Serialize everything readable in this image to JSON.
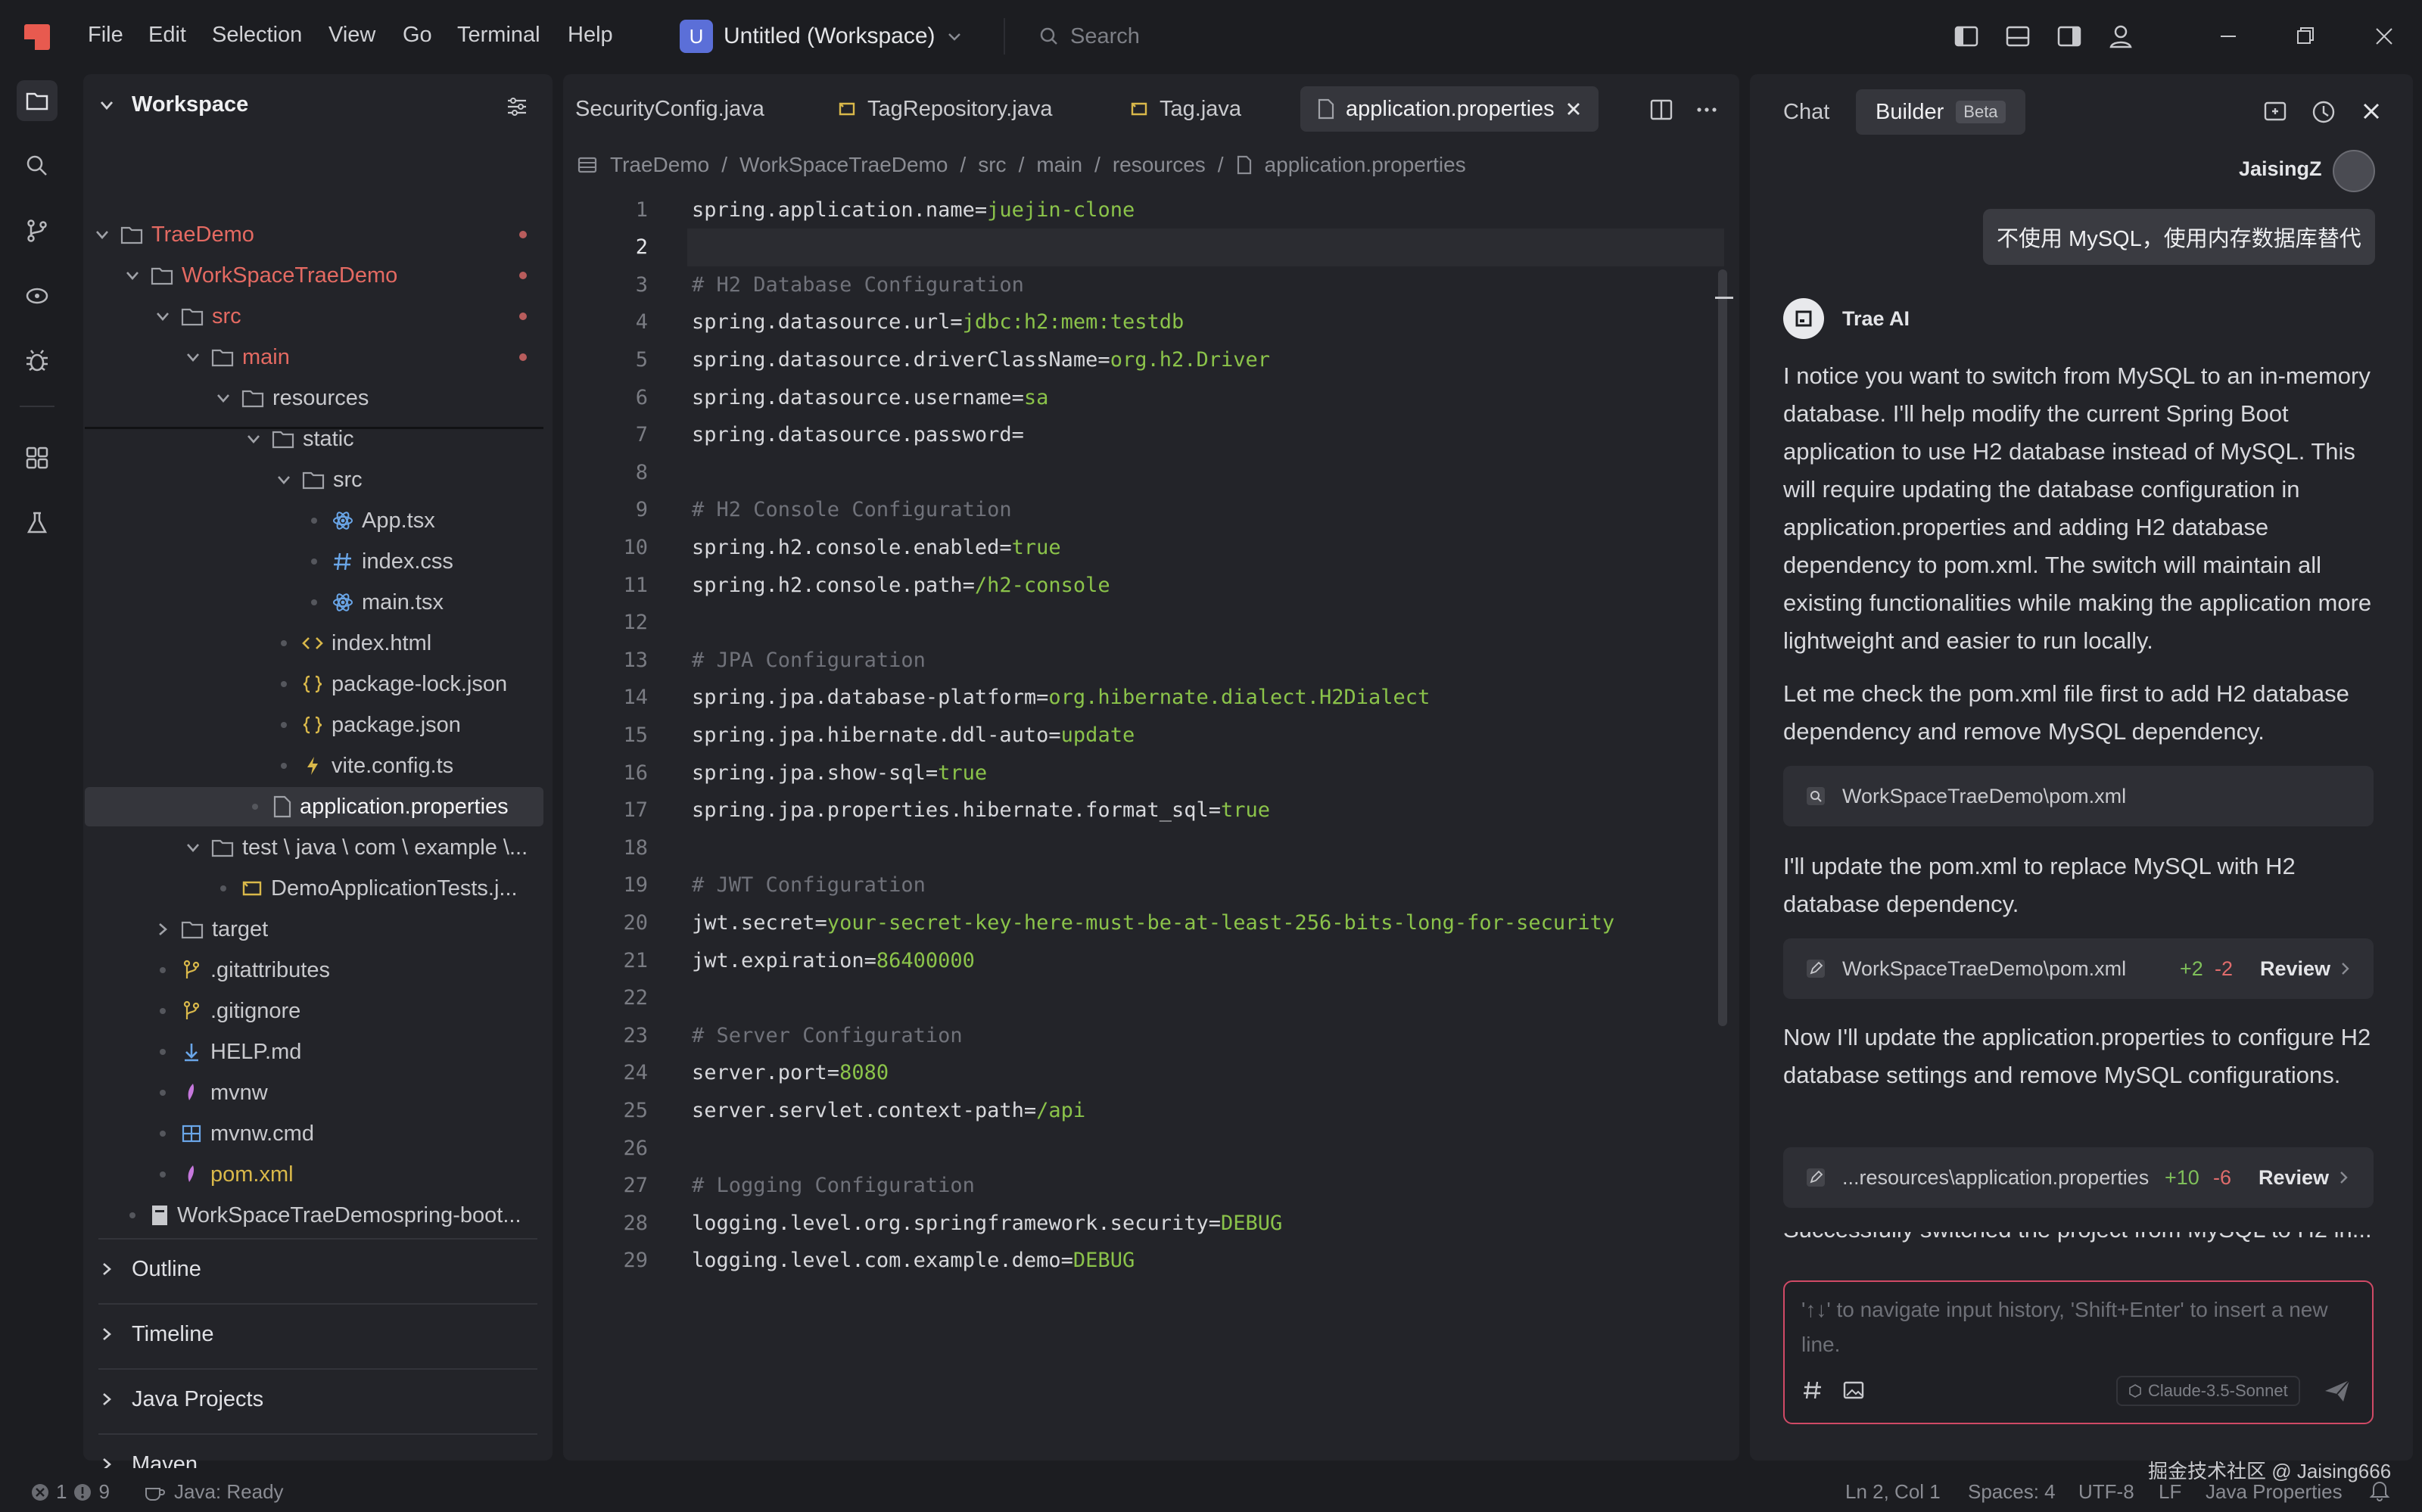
{
  "menu": [
    "File",
    "Edit",
    "Selection",
    "View",
    "Go",
    "Terminal",
    "Help"
  ],
  "workspace": {
    "badge": "U",
    "title": "Untitled (Workspace)"
  },
  "search": {
    "placeholder": "Search"
  },
  "explorer": {
    "title": "Workspace",
    "tree": [
      {
        "label": "TraeDemo",
        "indent": 0,
        "type": "folder",
        "open": true,
        "color": "red",
        "dot": true
      },
      {
        "label": "WorkSpaceTraeDemo",
        "indent": 1,
        "type": "folder",
        "open": true,
        "color": "red",
        "dot": true
      },
      {
        "label": "src",
        "indent": 2,
        "type": "folder",
        "open": true,
        "color": "red",
        "dot": true
      },
      {
        "label": "main",
        "indent": 3,
        "type": "folder",
        "open": true,
        "color": "red",
        "dot": true
      },
      {
        "label": "resources",
        "indent": 4,
        "type": "folder",
        "open": true
      },
      {
        "label": "static",
        "indent": 5,
        "type": "folder",
        "open": true
      },
      {
        "label": "src",
        "indent": 6,
        "type": "folder",
        "open": true
      },
      {
        "label": "App.tsx",
        "indent": 7,
        "type": "react"
      },
      {
        "label": "index.css",
        "indent": 7,
        "type": "css"
      },
      {
        "label": "main.tsx",
        "indent": 7,
        "type": "react"
      },
      {
        "label": "index.html",
        "indent": 6,
        "type": "html"
      },
      {
        "label": "package-lock.json",
        "indent": 6,
        "type": "json"
      },
      {
        "label": "package.json",
        "indent": 6,
        "type": "json"
      },
      {
        "label": "vite.config.ts",
        "indent": 6,
        "type": "vite"
      },
      {
        "label": "application.properties",
        "indent": 5,
        "type": "file",
        "selected": true
      },
      {
        "label": "test \\ java \\ com \\ example \\...",
        "indent": 3,
        "type": "folder",
        "open": true
      },
      {
        "label": "DemoApplicationTests.j...",
        "indent": 4,
        "type": "java"
      },
      {
        "label": "target",
        "indent": 2,
        "type": "folder",
        "open": false
      },
      {
        "label": ".gitattributes",
        "indent": 2,
        "type": "git"
      },
      {
        "label": ".gitignore",
        "indent": 2,
        "type": "git"
      },
      {
        "label": "HELP.md",
        "indent": 2,
        "type": "md"
      },
      {
        "label": "mvnw",
        "indent": 2,
        "type": "mvn"
      },
      {
        "label": "mvnw.cmd",
        "indent": 2,
        "type": "win"
      },
      {
        "label": "pom.xml",
        "indent": 2,
        "type": "mvn",
        "color": "yellow"
      },
      {
        "label": "WorkSpaceTraeDemospring-boot...",
        "indent": 1,
        "type": "file2"
      }
    ],
    "sections": [
      "Outline",
      "Timeline",
      "Java Projects",
      "Maven"
    ]
  },
  "editor": {
    "tabs": [
      {
        "label": "SecurityConfig.java",
        "icon": "none"
      },
      {
        "label": "TagRepository.java",
        "icon": "java"
      },
      {
        "label": "Tag.java",
        "icon": "java"
      },
      {
        "label": "application.properties",
        "icon": "file",
        "active": true
      }
    ],
    "breadcrumb": [
      "TraeDemo",
      "WorkSpaceTraeDemo",
      "src",
      "main",
      "resources",
      "application.properties"
    ],
    "lines": [
      {
        "n": "1",
        "k": "spring.application.name=",
        "v": "juejin-clone"
      },
      {
        "n": "2",
        "k": "",
        "v": ""
      },
      {
        "n": "3",
        "c": "# H2 Database Configuration"
      },
      {
        "n": "4",
        "k": "spring.datasource.url=",
        "v": "jdbc:h2:mem:testdb"
      },
      {
        "n": "5",
        "k": "spring.datasource.driverClassName=",
        "v": "org.h2.Driver"
      },
      {
        "n": "6",
        "k": "spring.datasource.username=",
        "v": "sa"
      },
      {
        "n": "7",
        "k": "spring.datasource.password=",
        "v": ""
      },
      {
        "n": "8",
        "k": "",
        "v": ""
      },
      {
        "n": "9",
        "c": "# H2 Console Configuration"
      },
      {
        "n": "10",
        "k": "spring.h2.console.enabled=",
        "v": "true"
      },
      {
        "n": "11",
        "k": "spring.h2.console.path=",
        "v": "/h2-console"
      },
      {
        "n": "12",
        "k": "",
        "v": ""
      },
      {
        "n": "13",
        "c": "# JPA Configuration"
      },
      {
        "n": "14",
        "k": "spring.jpa.database-platform=",
        "v": "org.hibernate.dialect.H2Dialect"
      },
      {
        "n": "15",
        "k": "spring.jpa.hibernate.ddl-auto=",
        "v": "update"
      },
      {
        "n": "16",
        "k": "spring.jpa.show-sql=",
        "v": "true"
      },
      {
        "n": "17",
        "k": "spring.jpa.properties.hibernate.format_sql=",
        "v": "true"
      },
      {
        "n": "18",
        "k": "",
        "v": ""
      },
      {
        "n": "19",
        "c": "# JWT Configuration"
      },
      {
        "n": "20",
        "k": "jwt.secret=",
        "v": "your-secret-key-here-must-be-at-least-256-bits-long-for-security"
      },
      {
        "n": "21",
        "k": "jwt.expiration=",
        "v": "86400000"
      },
      {
        "n": "22",
        "k": "",
        "v": ""
      },
      {
        "n": "23",
        "c": "# Server Configuration"
      },
      {
        "n": "24",
        "k": "server.port=",
        "v": "8080"
      },
      {
        "n": "25",
        "k": "server.servlet.context-path=",
        "v": "/api"
      },
      {
        "n": "26",
        "k": "",
        "v": ""
      },
      {
        "n": "27",
        "c": "# Logging Configuration"
      },
      {
        "n": "28",
        "k": "logging.level.org.springframework.security=",
        "v": "DEBUG"
      },
      {
        "n": "29",
        "k": "logging.level.com.example.demo=",
        "v": "DEBUG"
      }
    ]
  },
  "chat": {
    "tab_chat": "Chat",
    "tab_builder": "Builder",
    "builder_badge": "Beta",
    "user_name": "JaisingZ",
    "user_message": "不使用 MySQL，使用内存数据库替代",
    "ai_name": "Trae AI",
    "paragraphs": [
      "I notice you want to switch from MySQL to an in-memory database. I'll help modify the current Spring Boot application to use H2 database instead of MySQL. This will require updating the database configuration in application.properties and adding H2 database dependency to pom.xml. The switch will maintain all existing functionalities while making the application more lightweight and easier to run locally.",
      "Let me check the pom.xml file first to add H2 database dependency and remove MySQL dependency.",
      "I'll update the pom.xml to replace MySQL with H2 database dependency.",
      "Now I'll update the application.properties to configure H2 database settings and remove MySQL configurations.",
      "Successfully switched the project from MySQL to H2 in..."
    ],
    "tool1": "WorkSpaceTraeDemo\\pom.xml",
    "tool2": {
      "path": "WorkSpaceTraeDemo\\pom.xml",
      "add": "+2",
      "del": "-2",
      "action": "Review"
    },
    "tool3": {
      "path": "...resources\\application.properties",
      "add": "+10",
      "del": "-6",
      "action": "Review"
    },
    "input_placeholder": "'↑↓' to navigate input history, 'Shift+Enter' to insert a new line.",
    "model": "Claude-3.5-Sonnet"
  },
  "status": {
    "errors": "1",
    "warnings": "9",
    "java": "Java: Ready",
    "position": "Ln 2, Col 1",
    "spaces": "Spaces: 4",
    "encoding": "UTF-8",
    "eol": "LF",
    "language": "Java Properties",
    "watermark": "掘金技术社区 @ Jaising666"
  },
  "colors": {
    "accent_red": "#e46a62",
    "string_green": "#8bc34a",
    "input_border": "#d04a66",
    "ws_badge": "#5b6fd8"
  }
}
